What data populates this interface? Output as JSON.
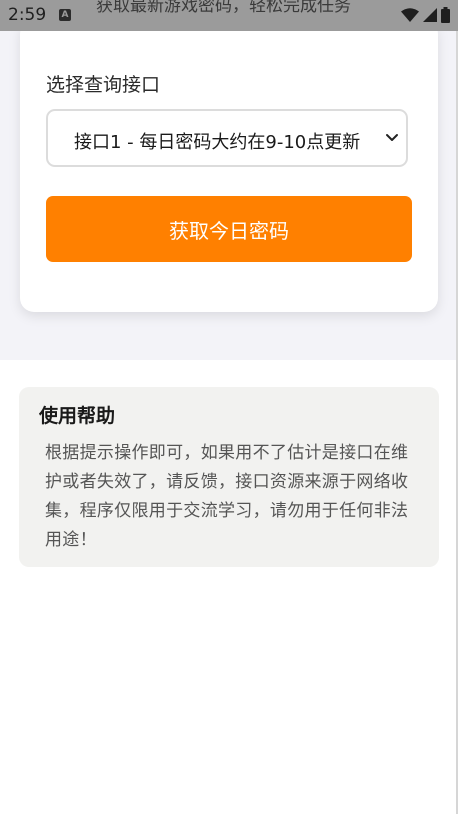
{
  "status_bar": {
    "time": "2:59",
    "notification_icon_letter": "A",
    "banner_text": "获取最新游戏密码，轻松完成任务",
    "icons": [
      "wifi-icon",
      "signal-icon",
      "battery-icon"
    ]
  },
  "query_card": {
    "select_label": "选择查询接口",
    "selected_interface": "接口1 - 每日密码大约在9-10点更新",
    "submit_button_label": "获取今日密码"
  },
  "help": {
    "title": "使用帮助",
    "body": "根据提示操作即可，如果用不了估计是接口在维护或者失效了，请反馈，接口资源来源于网络收集，程序仅限用于交流学习，请勿用于任何非法用途！"
  },
  "colors": {
    "accent": "#ff8000",
    "status_bar": "#9b9b9b",
    "page_background": "#f3f3f8",
    "help_background": "#f2f2f0"
  }
}
